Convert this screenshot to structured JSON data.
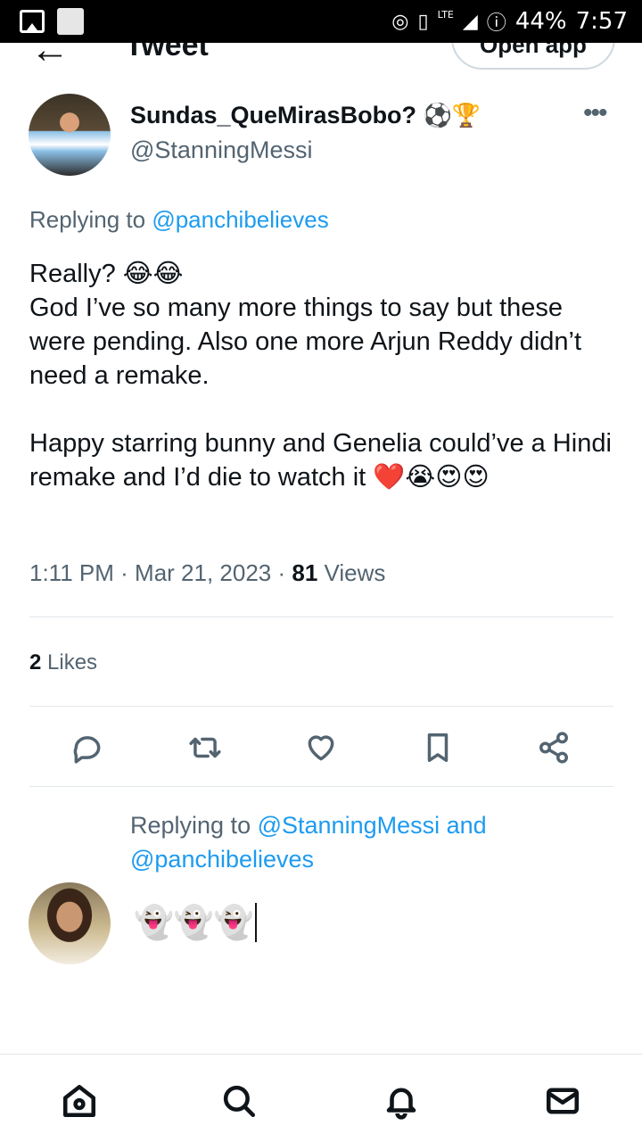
{
  "status_bar": {
    "battery": "44%",
    "time": "7:57",
    "network": "LTE"
  },
  "header": {
    "title": "Tweet",
    "open_app_label": "Open app"
  },
  "tweet": {
    "author_name": "Sundas_QueMirasBobo?",
    "author_name_emoji": "⚽🏆",
    "author_handle": "@StanningMessi",
    "replying_prefix": "Replying to",
    "replying_to": "@panchibelieves",
    "text_line1": "Really? 😂😂",
    "text_line2": "God I’ve so many more things to say but these were pending. Also one more Arjun Reddy didn’t need a remake.",
    "text_line3": "Happy starring bunny and Genelia could’ve a Hindi remake and I’d die to watch it ❤️😭😍😍",
    "time": "1:11 PM",
    "date": "Mar 21, 2023",
    "views_count": "81",
    "views_label": "Views",
    "likes_count": "2",
    "likes_label": "Likes"
  },
  "icons": {
    "reply": "reply-icon",
    "retweet": "retweet-icon",
    "like": "heart-icon",
    "bookmark": "bookmark-icon",
    "share": "share-icon",
    "more": "more-icon",
    "home": "home-icon",
    "search": "search-icon",
    "notifications": "bell-icon",
    "messages": "mail-icon"
  },
  "reply_composer": {
    "replying_prefix": "Replying to",
    "replying_to_1": "@StanningMessi",
    "and_word": "and",
    "replying_to_2": "@panchibelieves",
    "draft_text": "👻👻👻"
  },
  "colors": {
    "link": "#1d9bf0",
    "secondary_text": "#536471",
    "primary_text": "#0f1419"
  }
}
